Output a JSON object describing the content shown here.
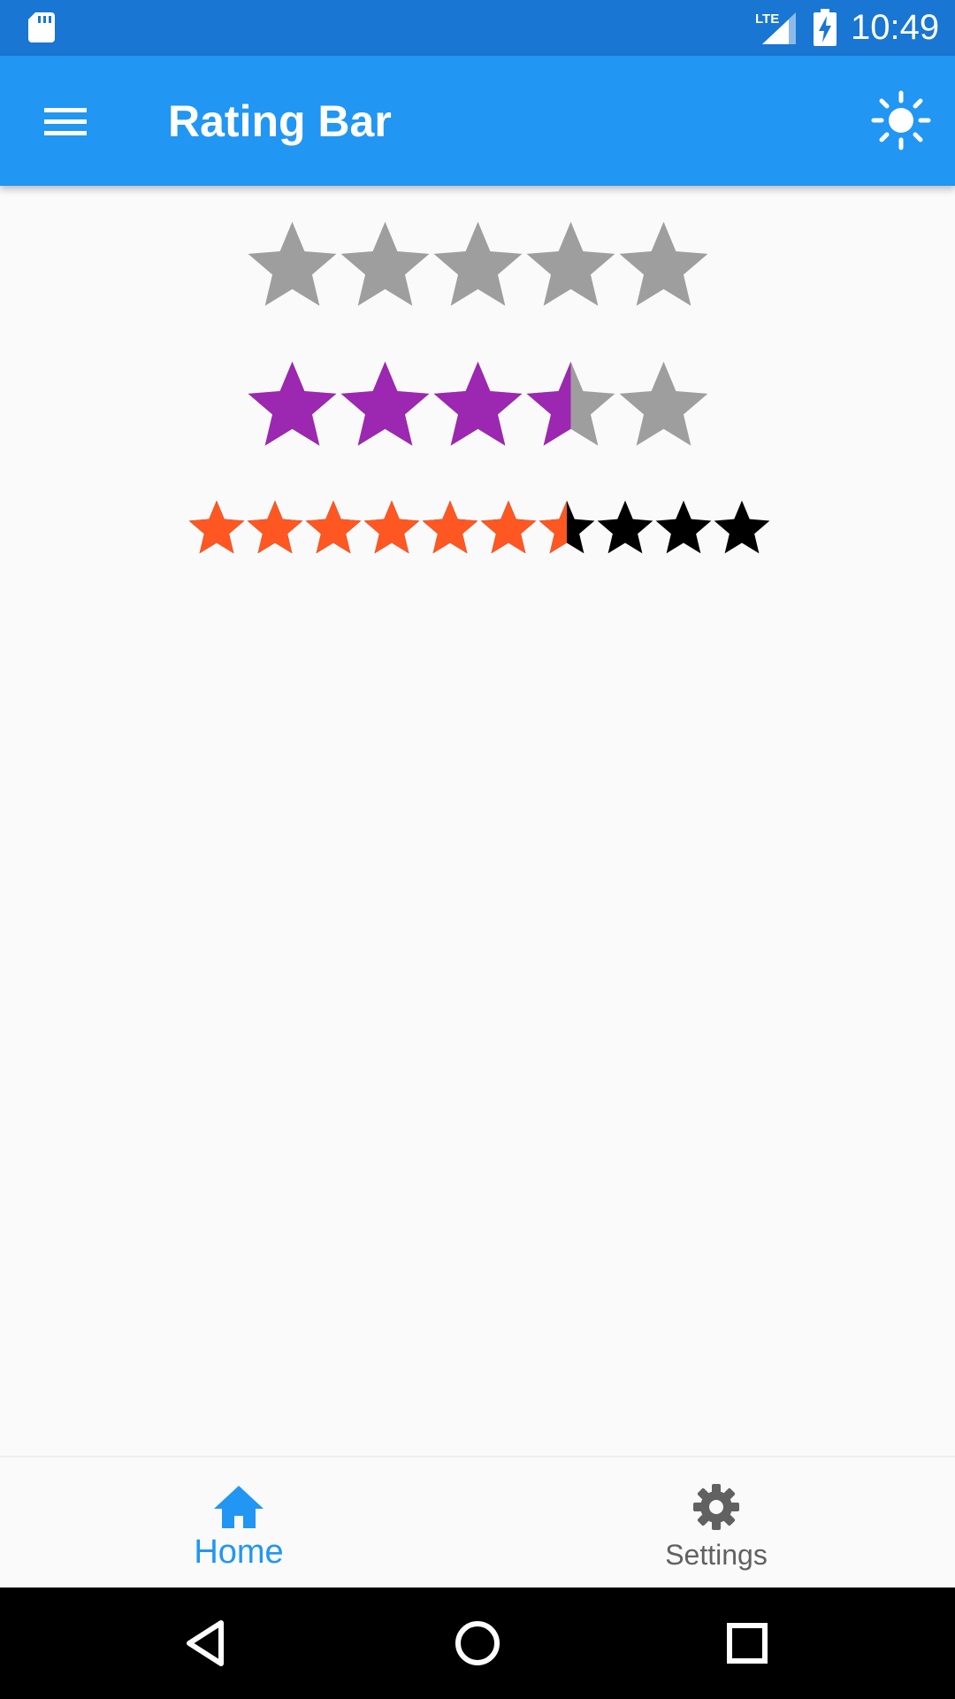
{
  "status_bar": {
    "time": "10:49",
    "network": "LTE",
    "icons": [
      "sd-card-icon",
      "lte-signal-icon",
      "battery-charging-icon"
    ]
  },
  "app_bar": {
    "title": "Rating Bar",
    "left_icon": "menu-icon",
    "right_icon": "brightness-icon"
  },
  "ratings": [
    {
      "rating": 0,
      "max": 5,
      "filled_color": "#9C27B0",
      "empty_color": "#9E9E9E"
    },
    {
      "rating": 3.5,
      "max": 5,
      "filled_color": "#9C27B0",
      "empty_color": "#9E9E9E"
    },
    {
      "rating": 6.5,
      "max": 10,
      "filled_color": "#FF5722",
      "empty_color": "#000000"
    }
  ],
  "bottom_nav": {
    "items": [
      {
        "label": "Home",
        "icon": "home-icon",
        "active": true,
        "color": "#2196F3"
      },
      {
        "label": "Settings",
        "icon": "settings-gear-icon",
        "active": false,
        "color": "#616161"
      }
    ]
  },
  "system_nav": {
    "icons": [
      "back-icon",
      "home-circle-icon",
      "recents-icon"
    ]
  }
}
